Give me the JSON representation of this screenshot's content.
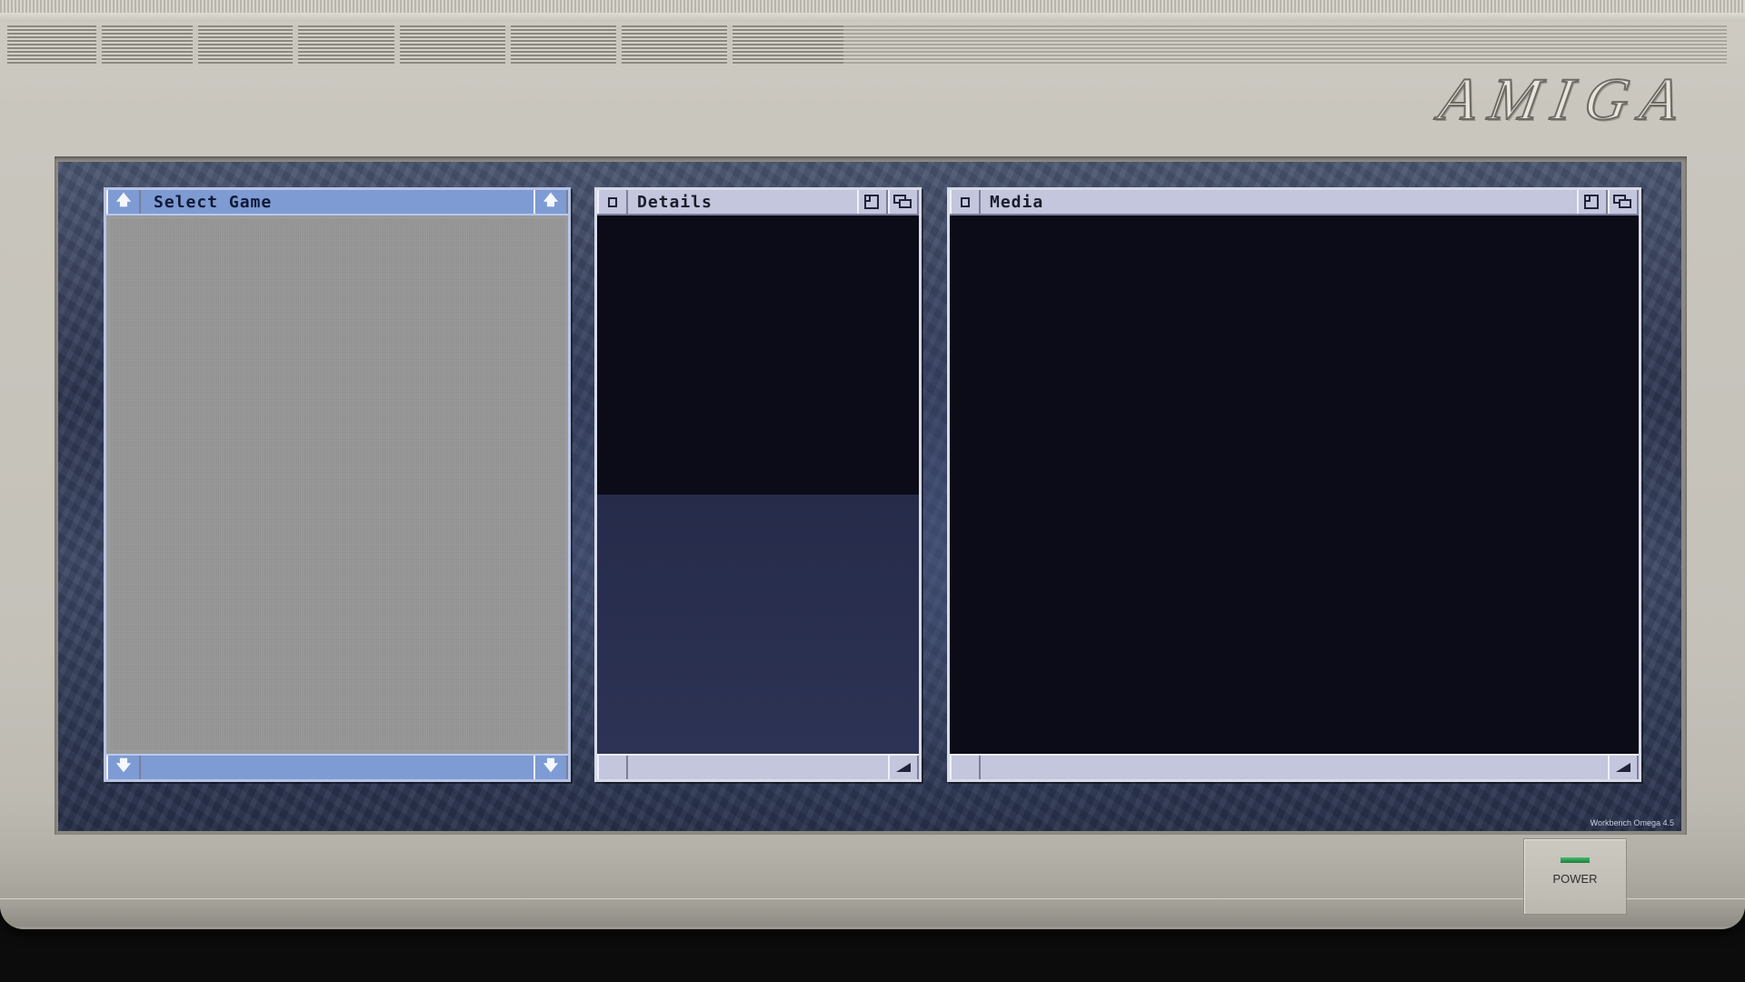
{
  "case": {
    "logo": "AMIGA",
    "power_label": "POWER",
    "power_led_color": "#3fbf6a"
  },
  "screen": {
    "version_text": "Workbench Omega 4.5"
  },
  "windows": {
    "select_game": {
      "title": "Select Game",
      "scroll_up_icon": "arrow-up-icon",
      "scroll_down_icon": "arrow-down-icon",
      "title_color": "#7e9bd3"
    },
    "details": {
      "title": "Details",
      "close_icon": "close-gadget-icon",
      "zoom_icon": "zoom-gadget-icon",
      "depth_icon": "depth-gadget-icon",
      "size_icon": "size-gadget-icon"
    },
    "media": {
      "title": "Media",
      "close_icon": "close-gadget-icon",
      "zoom_icon": "zoom-gadget-icon",
      "depth_icon": "depth-gadget-icon",
      "size_icon": "size-gadget-icon"
    }
  }
}
